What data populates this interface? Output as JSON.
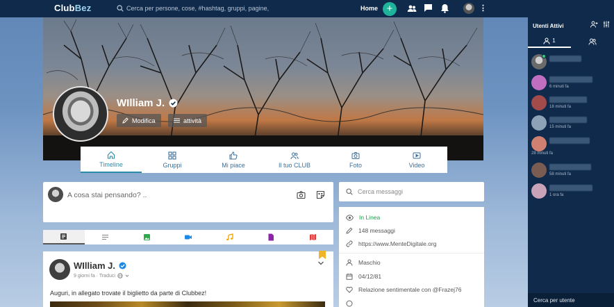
{
  "app": {
    "logo": "ClubBez",
    "logo_main": "Club",
    "logo_accent": "Bez"
  },
  "topbar": {
    "search_placeholder": "Cerca per persone, cose, #hashtag, gruppi, pagine,",
    "home_label": "Home",
    "plus_icon": "+",
    "icons": [
      "users-icon",
      "chat-icon",
      "bell-icon",
      "avatar",
      "more-vertical-icon"
    ]
  },
  "profile": {
    "name": "WIlliam J.",
    "verified": true,
    "edit_label": "Modifica",
    "activity_label": "attività"
  },
  "tabs": [
    {
      "label": "Timeline",
      "icon": "home-icon",
      "active": true
    },
    {
      "label": "Gruppi",
      "icon": "grid-icon"
    },
    {
      "label": "Mi piace",
      "icon": "thumbs-up-icon"
    },
    {
      "label": "Il tuo CLUB",
      "icon": "users-icon"
    },
    {
      "label": "Foto",
      "icon": "camera-icon"
    },
    {
      "label": "Video",
      "icon": "video-icon"
    }
  ],
  "composer": {
    "placeholder": "A cosa stai pensando? .."
  },
  "post_types": [
    {
      "icon": "text-box-icon",
      "color": "#444444",
      "selected": true
    },
    {
      "icon": "align-left-icon",
      "color": "#888888"
    },
    {
      "icon": "image-icon",
      "color": "#2eaa4a"
    },
    {
      "icon": "video-camera-icon",
      "color": "#1e88e5"
    },
    {
      "icon": "music-icon",
      "color": "#f0a500"
    },
    {
      "icon": "file-icon",
      "color": "#8e24aa"
    },
    {
      "icon": "map-icon",
      "color": "#e53935"
    }
  ],
  "post": {
    "author": "WIlliam J.",
    "meta": "9 giorni fa · Traduci",
    "text": "Auguri, in allegato trovate il biglietto da parte di Clubbez!"
  },
  "messages_search": {
    "placeholder": "Cerca messaggi"
  },
  "info": {
    "status": "In Linea",
    "messages": "148 messaggi",
    "website": "https://www.MenteDigitale.org",
    "gender": "Maschio",
    "birthday": "04/12/81",
    "relationship": "Relazione sentimentale con @Frazej76"
  },
  "right_panel": {
    "title": "Utenti Attivi",
    "tab_online_count": "1",
    "users": [
      {
        "time": "",
        "online": true,
        "color": "#8a8a8a"
      },
      {
        "time": "6 minuti fa",
        "color": "#c06fc0"
      },
      {
        "time": "18 minuti fa",
        "color": "#a34a4a"
      },
      {
        "time": "15 minuti fa",
        "color": "#8da2b7"
      },
      {
        "time": "28 minuti fa",
        "color": "#d08070"
      },
      {
        "time": "58 minuti fa",
        "color": "#7a5c52"
      },
      {
        "time": "1 ora fa",
        "color": "#c9a3b8"
      }
    ],
    "footer": "Cerca per utente"
  },
  "colors": {
    "nav_bg": "#0f2a4a",
    "accent": "#1eb39a",
    "tab_active": "#2a8aa8",
    "online": "#1f9d4a"
  }
}
